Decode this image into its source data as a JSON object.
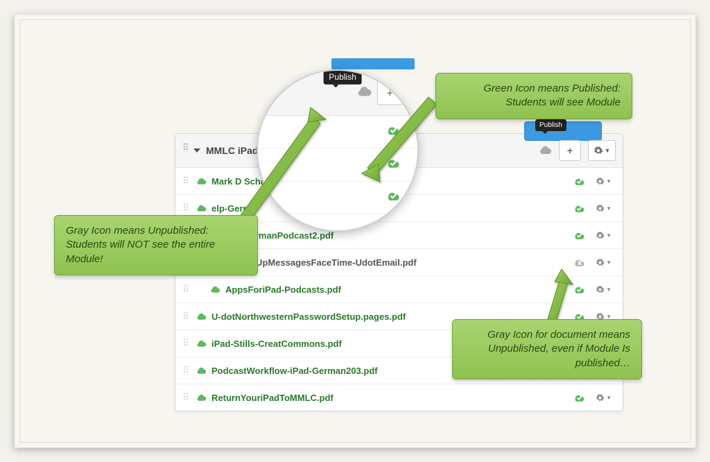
{
  "tooltips": {
    "publish": "Publish"
  },
  "module": {
    "title": "MMLC iPad",
    "items": [
      {
        "name": "Mark D Schaefer",
        "published": true,
        "dark": false
      },
      {
        "name": "elp-Gern",
        "published": true,
        "dark": false
      },
      {
        "name": "orHelp-GermanPodcast2.pdf",
        "published": true,
        "dark": false
      },
      {
        "name": "SettingUpMessagesFaceTime-UdotEmail.pdf",
        "published": false,
        "dark": true
      },
      {
        "name": "AppsForiPad-Podcasts.pdf",
        "published": true,
        "dark": false
      },
      {
        "name": "U-dotNorthwesternPasswordSetup.pages.pdf",
        "published": true,
        "dark": false
      },
      {
        "name": "iPad-Stills-CreatCommons.pdf",
        "published": true,
        "dark": false
      },
      {
        "name": "PodcastWorkflow-iPad-German203.pdf",
        "published": true,
        "dark": false
      },
      {
        "name": "ReturnYouriPadToMMLC.pdf",
        "published": true,
        "dark": false
      }
    ]
  },
  "annotations": {
    "green": "Green Icon means Published: Students will see Module",
    "gray_module": "Gray Icon means Unpublished: Students will NOT see the entire Module!",
    "gray_doc": "Gray Icon for document means Unpublished, even if Module Is published…"
  },
  "icons": {
    "plus": "+",
    "gear": "gear-icon",
    "caret": "caret-down-icon",
    "cloud": "cloud-icon",
    "check": "checkmark-icon",
    "x": "x-icon"
  },
  "colors": {
    "published": "#5eb85e",
    "unpublished": "#b0b0b0",
    "accent": "#3b9ae1",
    "anno_bg": "#8fc251"
  }
}
